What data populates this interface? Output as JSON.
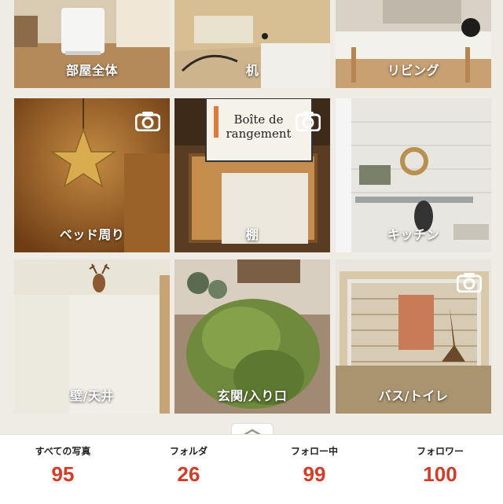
{
  "folders": [
    {
      "label": "部屋全体",
      "camera": false
    },
    {
      "label": "机",
      "camera": false
    },
    {
      "label": "リビング",
      "camera": false
    },
    {
      "label": "ベッド周り",
      "camera": true
    },
    {
      "label": "棚",
      "camera": true
    },
    {
      "label": "キッチン",
      "camera": false
    },
    {
      "label": "壁/天井",
      "camera": false
    },
    {
      "label": "玄関/入り口",
      "camera": false
    },
    {
      "label": "バス/トイレ",
      "camera": true
    }
  ],
  "shelf_box_text": [
    "Boîte de",
    "rangement"
  ],
  "stats": [
    {
      "title": "すべての写真",
      "value": "95"
    },
    {
      "title": "フォルダ",
      "value": "26"
    },
    {
      "title": "フォロー中",
      "value": "99"
    },
    {
      "title": "フォロワー",
      "value": "100"
    }
  ],
  "colors": {
    "accent": "#d93a26",
    "background": "#efece6"
  },
  "icons": {
    "camera": "camera-icon",
    "handle": "chevron-up-icon"
  }
}
